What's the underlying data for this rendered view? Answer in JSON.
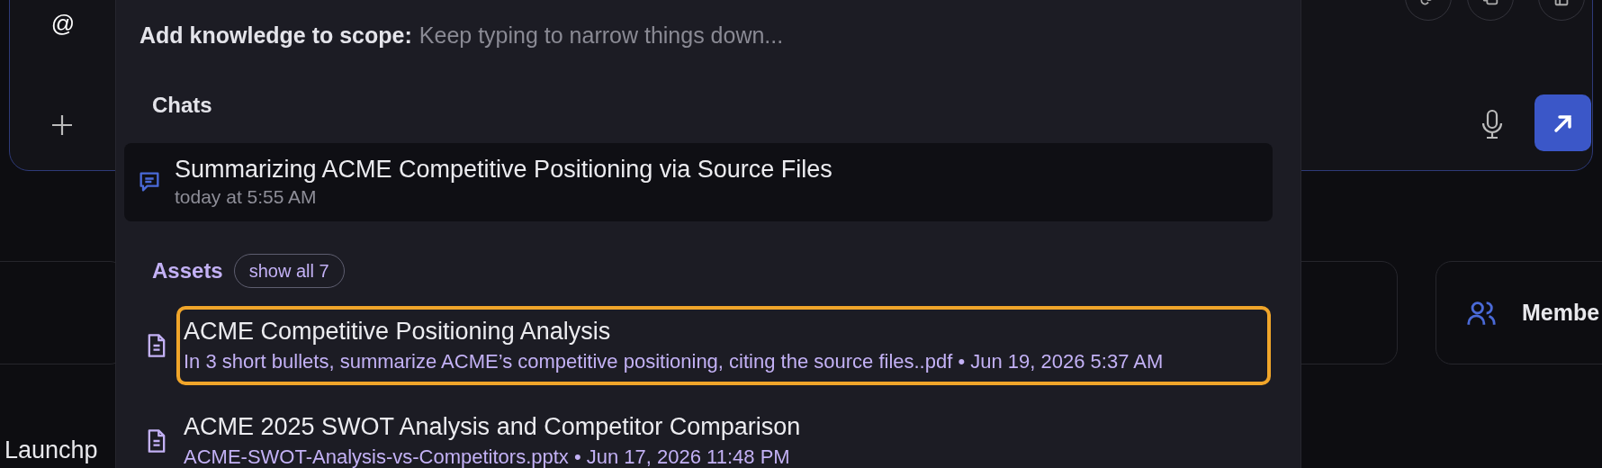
{
  "composer": {
    "mention": "@"
  },
  "background": {
    "cards": [
      {
        "kind": "plain"
      },
      {
        "kind": "members",
        "label": "Membe"
      }
    ],
    "launch_label": "Launchp"
  },
  "popup": {
    "label": "Add knowledge to scope:",
    "placeholder": "Keep typing to narrow things down...",
    "chats": {
      "heading": "Chats",
      "items": [
        {
          "title": "Summarizing ACME Competitive Positioning via Source Files",
          "subtitle": "today at 5:55 AM"
        }
      ]
    },
    "assets": {
      "heading": "Assets",
      "show_all": "show all 7",
      "items": [
        {
          "title": "ACME Competitive Positioning Analysis",
          "subtitle": "In 3 short bullets, summarize ACME’s competitive positioning, citing the source files..pdf • Jun 19, 2026 5:37 AM",
          "selected": true
        },
        {
          "title": "ACME 2025 SWOT Analysis and Competitor Comparison",
          "subtitle": "ACME-SWOT-Analysis-vs-Competitors.pptx • Jun 17, 2026 11:48 PM",
          "selected": false
        }
      ]
    }
  }
}
